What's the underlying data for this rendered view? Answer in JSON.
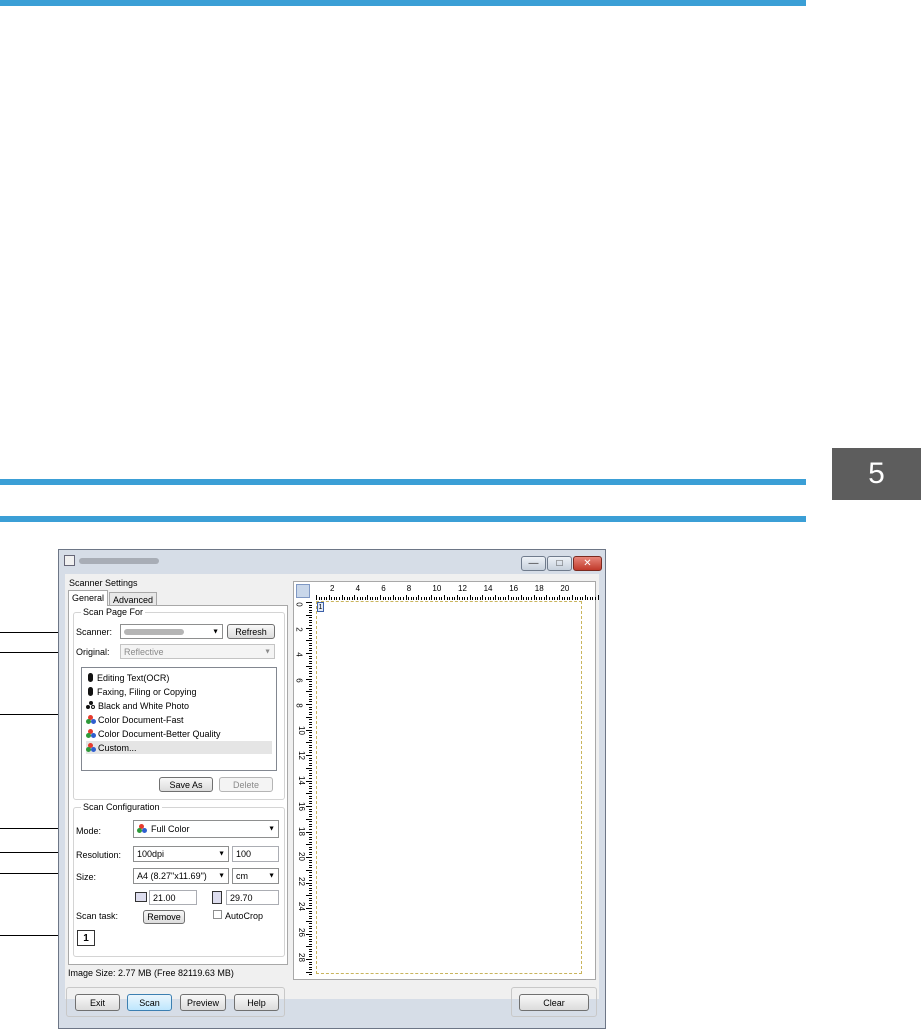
{
  "chapter_tab": "5",
  "window": {
    "title_buttons": {
      "minimize": "—",
      "maximize": "□",
      "close": "✕"
    },
    "scanner_settings_label": "Scanner Settings",
    "tabs": [
      "General",
      "Advanced"
    ],
    "scan_page_for_label": "Scan Page For",
    "scanner_label": "Scanner:",
    "refresh_button": "Refresh",
    "original_label": "Original:",
    "original_value": "Reflective",
    "presets": [
      {
        "label": "Editing Text(OCR)",
        "icon": "person-icon"
      },
      {
        "label": "Faxing, Filing or Copying",
        "icon": "person-icon"
      },
      {
        "label": "Black and White Photo",
        "icon": "bw-photo-icon"
      },
      {
        "label": "Color Document-Fast",
        "icon": "color-icon"
      },
      {
        "label": "Color Document-Better Quality",
        "icon": "color-icon"
      },
      {
        "label": "Custom...",
        "icon": "color-icon"
      }
    ],
    "save_as_button": "Save As",
    "delete_button": "Delete",
    "scan_configuration_label": "Scan Configuration",
    "mode_label": "Mode:",
    "mode_value": "Full Color",
    "resolution_label": "Resolution:",
    "resolution_value": "100dpi",
    "resolution_number": "100",
    "size_label": "Size:",
    "size_value": "A4 (8.27\"x11.69\")",
    "unit_value": "cm",
    "width_value": "21.00",
    "height_value": "29.70",
    "scan_task_label": "Scan task:",
    "remove_button": "Remove",
    "autocrop_label": "AutoCrop",
    "task_number": "1",
    "image_size_text": "Image Size: 2.77 MB (Free 82119.63 MB)",
    "exit_button": "Exit",
    "scan_button": "Scan",
    "preview_button": "Preview",
    "help_button": "Help",
    "clear_button": "Clear",
    "ruler_h_labels": [
      "2",
      "4",
      "6",
      "8",
      "10",
      "12",
      "14",
      "16",
      "18",
      "20"
    ],
    "ruler_v_labels": [
      "0",
      "2",
      "4",
      "6",
      "8",
      "10",
      "12",
      "14",
      "16",
      "18",
      "20",
      "22",
      "24",
      "26",
      "28"
    ],
    "page_marker": "1"
  },
  "colors": {
    "rule": "#3b9fd6",
    "chapter_tab_bg": "#5d5d5d",
    "window_frame": "#d6dde7"
  }
}
